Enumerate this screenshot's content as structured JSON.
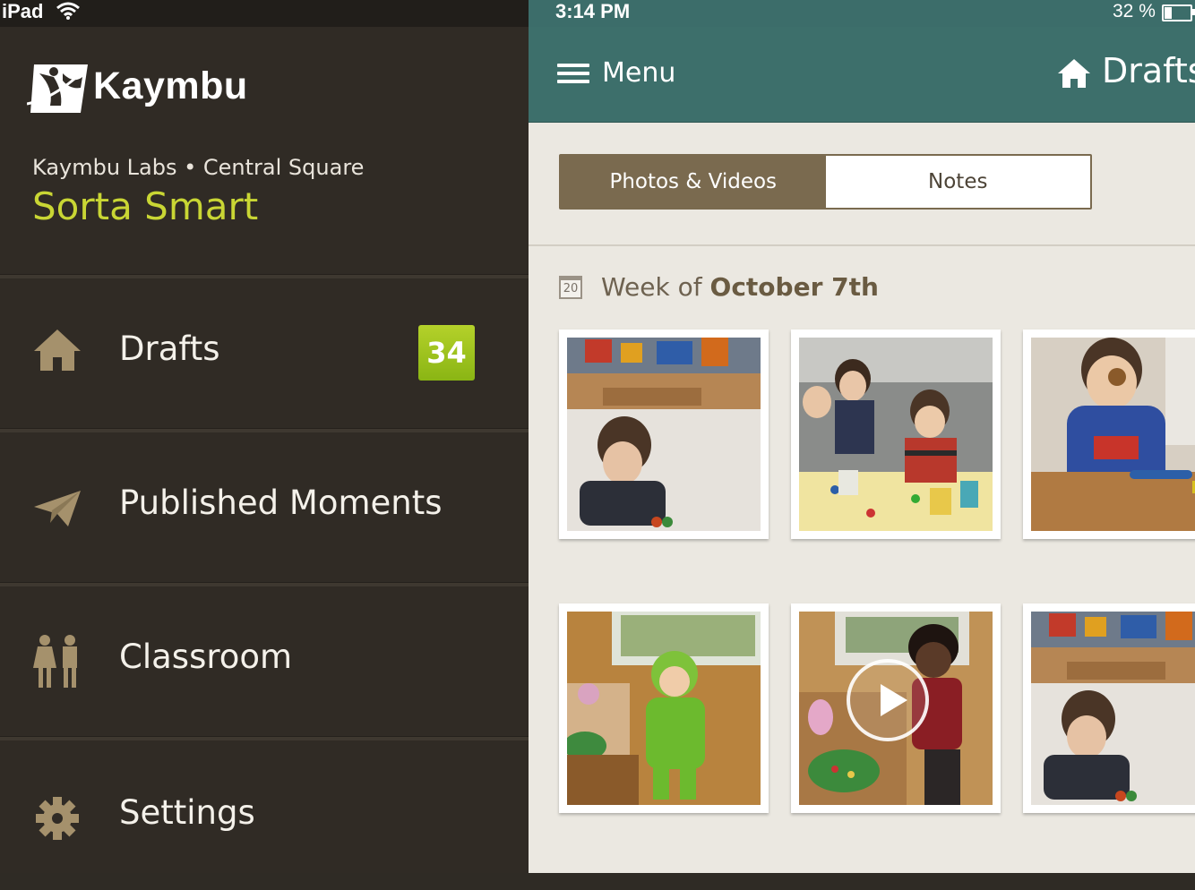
{
  "status_bar": {
    "device": "iPad",
    "time": "3:14 PM",
    "battery": "32 %"
  },
  "sidebar": {
    "brand": "Kaymbu",
    "school": "Kaymbu Labs • Central Square",
    "class_name": "Sorta Smart",
    "items": [
      {
        "label": "Drafts",
        "icon": "home-icon",
        "badge": "34"
      },
      {
        "label": "Published Moments",
        "icon": "paper-plane-icon"
      },
      {
        "label": "Classroom",
        "icon": "children-icon"
      },
      {
        "label": "Settings",
        "icon": "gear-icon"
      }
    ]
  },
  "header": {
    "menu_label": "Menu",
    "title": "Drafts"
  },
  "tabs": [
    {
      "label": "Photos & Videos",
      "active": true
    },
    {
      "label": "Notes",
      "active": false
    }
  ],
  "section": {
    "calendar_day": "20",
    "week_prefix": "Week of ",
    "week_date": "October 7th"
  },
  "photos": [
    {
      "subject": "child-at-table",
      "is_video": false
    },
    {
      "subject": "children-painting",
      "is_video": false
    },
    {
      "subject": "child-eating",
      "is_video": false
    },
    {
      "subject": "child-dragon-costume",
      "is_video": false
    },
    {
      "subject": "child-play-kitchen",
      "is_video": true
    },
    {
      "subject": "child-at-table",
      "is_video": false
    }
  ],
  "colors": {
    "sidebar_bg": "#302b25",
    "accent_green": "#c9d634",
    "topbar_teal": "#3d6f6b",
    "tab_brown": "#7a6a4f",
    "main_bg": "#ebe8e1"
  }
}
